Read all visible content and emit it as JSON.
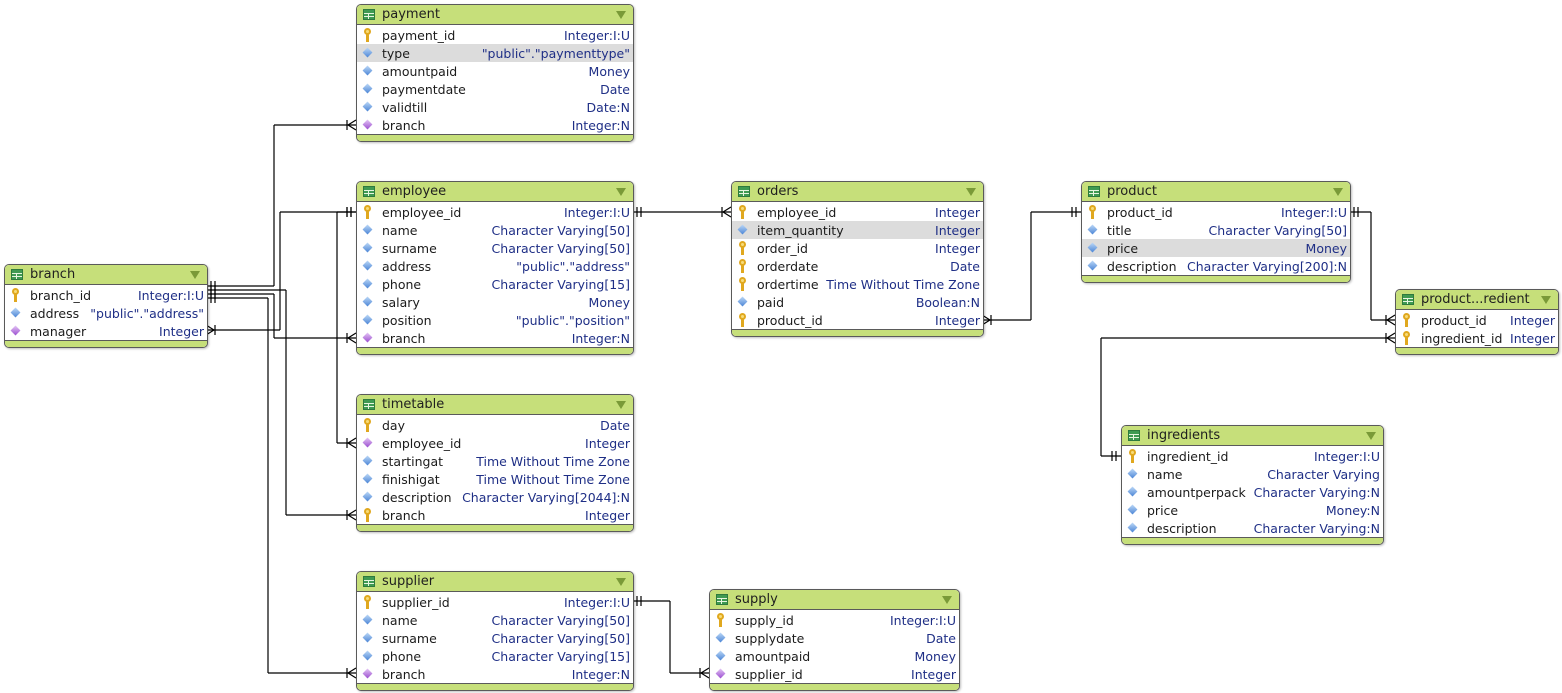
{
  "diagram": {
    "colors": {
      "header": "#c6df7a",
      "type_text": "#1f2f86",
      "line": "#000000"
    },
    "tables": [
      {
        "id": "payment",
        "name": "payment",
        "columns": [
          {
            "name": "payment_id",
            "type": "Integer:I:U",
            "icon": "key-icon"
          },
          {
            "name": "type",
            "type": "\"public\".\"paymenttype\"",
            "icon": "attribute-icon",
            "selected": true
          },
          {
            "name": "amountpaid",
            "type": "Money",
            "icon": "attribute-icon"
          },
          {
            "name": "paymentdate",
            "type": "Date",
            "icon": "attribute-icon"
          },
          {
            "name": "validtill",
            "type": "Date:N",
            "icon": "attribute-icon"
          },
          {
            "name": "branch",
            "type": "Integer:N",
            "icon": "foreign-key-icon"
          }
        ]
      },
      {
        "id": "employee",
        "name": "employee",
        "columns": [
          {
            "name": "employee_id",
            "type": "Integer:I:U",
            "icon": "key-icon"
          },
          {
            "name": "name",
            "type": "Character Varying[50]",
            "icon": "attribute-icon"
          },
          {
            "name": "surname",
            "type": "Character Varying[50]",
            "icon": "attribute-icon"
          },
          {
            "name": "address",
            "type": "\"public\".\"address\"",
            "icon": "attribute-icon"
          },
          {
            "name": "phone",
            "type": "Character Varying[15]",
            "icon": "attribute-icon"
          },
          {
            "name": "salary",
            "type": "Money",
            "icon": "attribute-icon"
          },
          {
            "name": "position",
            "type": "\"public\".\"position\"",
            "icon": "attribute-icon"
          },
          {
            "name": "branch",
            "type": "Integer:N",
            "icon": "foreign-key-icon"
          }
        ]
      },
      {
        "id": "branch",
        "name": "branch",
        "columns": [
          {
            "name": "branch_id",
            "type": "Integer:I:U",
            "icon": "key-icon"
          },
          {
            "name": "address",
            "type": "\"public\".\"address\"",
            "icon": "attribute-icon"
          },
          {
            "name": "manager",
            "type": "Integer",
            "icon": "foreign-key-icon"
          }
        ]
      },
      {
        "id": "timetable",
        "name": "timetable",
        "columns": [
          {
            "name": "day",
            "type": "Date",
            "icon": "key-icon"
          },
          {
            "name": "employee_id",
            "type": "Integer",
            "icon": "foreign-key-icon"
          },
          {
            "name": "startingat",
            "type": "Time Without Time Zone",
            "icon": "attribute-icon"
          },
          {
            "name": "finishigat",
            "type": "Time Without Time Zone",
            "icon": "attribute-icon"
          },
          {
            "name": "description",
            "type": "Character Varying[2044]:N",
            "icon": "attribute-icon"
          },
          {
            "name": "branch",
            "type": "Integer",
            "icon": "key-icon"
          }
        ]
      },
      {
        "id": "supplier",
        "name": "supplier",
        "columns": [
          {
            "name": "supplier_id",
            "type": "Integer:I:U",
            "icon": "key-icon"
          },
          {
            "name": "name",
            "type": "Character Varying[50]",
            "icon": "attribute-icon"
          },
          {
            "name": "surname",
            "type": "Character Varying[50]",
            "icon": "attribute-icon"
          },
          {
            "name": "phone",
            "type": "Character Varying[15]",
            "icon": "attribute-icon"
          },
          {
            "name": "branch",
            "type": "Integer:N",
            "icon": "foreign-key-icon"
          }
        ]
      },
      {
        "id": "supply",
        "name": "supply",
        "columns": [
          {
            "name": "supply_id",
            "type": "Integer:I:U",
            "icon": "key-icon"
          },
          {
            "name": "supplydate",
            "type": "Date",
            "icon": "attribute-icon"
          },
          {
            "name": "amountpaid",
            "type": "Money",
            "icon": "attribute-icon"
          },
          {
            "name": "supplier_id",
            "type": "Integer",
            "icon": "foreign-key-icon"
          }
        ]
      },
      {
        "id": "orders",
        "name": "orders",
        "columns": [
          {
            "name": "employee_id",
            "type": "Integer",
            "icon": "key-icon"
          },
          {
            "name": "item_quantity",
            "type": "Integer",
            "icon": "attribute-icon",
            "selected": true
          },
          {
            "name": "order_id",
            "type": "Integer",
            "icon": "key-icon"
          },
          {
            "name": "orderdate",
            "type": "Date",
            "icon": "key-icon"
          },
          {
            "name": "ordertime",
            "type": "Time Without Time Zone",
            "icon": "key-icon"
          },
          {
            "name": "paid",
            "type": "Boolean:N",
            "icon": "attribute-icon"
          },
          {
            "name": "product_id",
            "type": "Integer",
            "icon": "key-icon"
          }
        ]
      },
      {
        "id": "product",
        "name": "product",
        "columns": [
          {
            "name": "product_id",
            "type": "Integer:I:U",
            "icon": "key-icon"
          },
          {
            "name": "title",
            "type": "Character Varying[50]",
            "icon": "attribute-icon"
          },
          {
            "name": "price",
            "type": "Money",
            "icon": "attribute-icon",
            "selected": true
          },
          {
            "name": "description",
            "type": "Character Varying[200]:N",
            "icon": "attribute-icon"
          }
        ]
      },
      {
        "id": "product_ingredient",
        "name": "product...redient",
        "columns": [
          {
            "name": "product_id",
            "type": "Integer",
            "icon": "key-icon"
          },
          {
            "name": "ingredient_id",
            "type": "Integer",
            "icon": "key-icon"
          }
        ]
      },
      {
        "id": "ingredients",
        "name": "ingredients",
        "columns": [
          {
            "name": "ingredient_id",
            "type": "Integer:I:U",
            "icon": "key-icon"
          },
          {
            "name": "name",
            "type": "Character Varying",
            "icon": "attribute-icon"
          },
          {
            "name": "amountperpack",
            "type": "Character Varying:N",
            "icon": "attribute-icon"
          },
          {
            "name": "price",
            "type": "Money:N",
            "icon": "attribute-icon"
          },
          {
            "name": "description",
            "type": "Character Varying:N",
            "icon": "attribute-icon"
          }
        ]
      }
    ],
    "relationships": [
      {
        "from": "branch.branch_id",
        "to": "payment.branch",
        "from_end": "one",
        "to_end": "many"
      },
      {
        "from": "branch.branch_id",
        "to": "timetable.branch",
        "from_end": "one",
        "to_end": "many"
      },
      {
        "from": "branch.branch_id",
        "to": "employee.branch",
        "from_end": "one",
        "to_end": "many"
      },
      {
        "from": "branch.branch_id",
        "to": "supplier.branch",
        "from_end": "one",
        "to_end": "many"
      },
      {
        "from": "employee.employee_id",
        "to": "branch.manager",
        "from_end": "one",
        "to_end": "many"
      },
      {
        "from": "employee.employee_id",
        "to": "timetable.employee_id",
        "from_end": "one",
        "to_end": "many"
      },
      {
        "from": "employee.employee_id",
        "to": "orders.employee_id",
        "from_end": "one",
        "to_end": "many"
      },
      {
        "from": "product.product_id",
        "to": "orders.product_id",
        "from_end": "one",
        "to_end": "many"
      },
      {
        "from": "product.product_id",
        "to": "product_ingredient.product_id",
        "from_end": "one",
        "to_end": "many"
      },
      {
        "from": "ingredients.ingredient_id",
        "to": "product_ingredient.ingredient_id",
        "from_end": "one",
        "to_end": "many"
      },
      {
        "from": "supplier.supplier_id",
        "to": "supply.supplier_id",
        "from_end": "one",
        "to_end": "many"
      }
    ]
  }
}
